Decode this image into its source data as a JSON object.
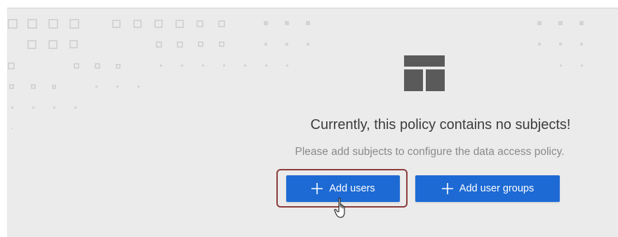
{
  "empty_state": {
    "heading": "Currently, this policy contains no subjects!",
    "message": "Please add subjects to configure the data access policy.",
    "icon": "layout-grid-icon"
  },
  "actions": {
    "add_users_label": "Add users",
    "add_user_groups_label": "Add user groups",
    "button_icon": "plus-icon"
  },
  "colors": {
    "panel_background": "#ebebeb",
    "button_primary": "#1d6ad4",
    "highlight_border": "#8c3b3b",
    "heading_text": "#3c3c3c",
    "subtext": "#8a8a8a"
  }
}
